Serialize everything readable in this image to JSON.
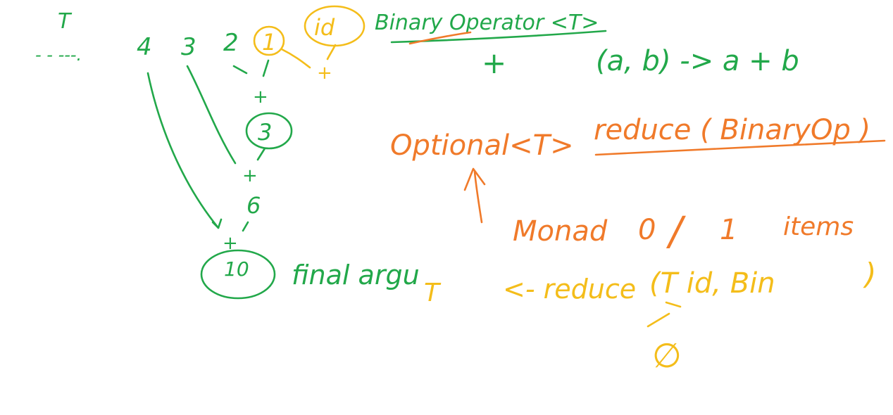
{
  "colors": {
    "green": "#22a84a",
    "orange": "#f07a2a",
    "yellow": "#f4bd1a",
    "background": "#ffffff"
  },
  "left": {
    "type_label": "T",
    "ellipsis": "- - ‐‐‐.",
    "numbers": [
      "4",
      "3",
      "2",
      "1"
    ],
    "identity": "id",
    "ops": [
      "+",
      "+",
      "+",
      "+"
    ],
    "partials": [
      "3",
      "6",
      "10"
    ],
    "final_label": "final argu"
  },
  "top_right": {
    "binary_operator": "Binary Operator <T>",
    "plus": "+",
    "lambda": "(a, b) -> a + b"
  },
  "middle": {
    "optional": "Optional<T>",
    "reduce_call": "reduce ( BinaryOp )",
    "monad": "Monad",
    "zero": "0",
    "slash": "/",
    "one": "1",
    "items": "items"
  },
  "bottom": {
    "t_result": "T",
    "arrow_reduce": "<- reduce",
    "args": "(T id, Bin",
    "close_paren": ")",
    "empty_set": "∅"
  }
}
